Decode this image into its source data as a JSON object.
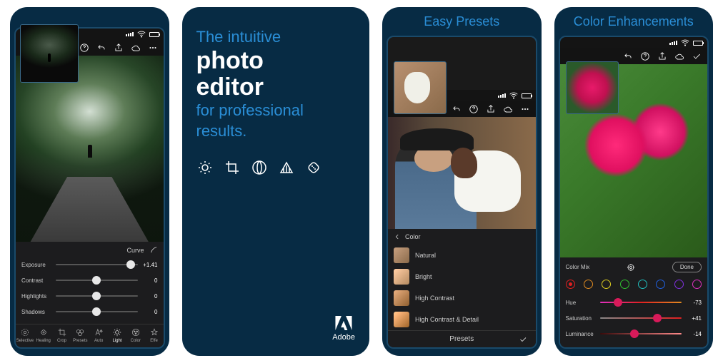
{
  "cards": {
    "editor": {
      "curve_label": "Curve",
      "sliders": [
        {
          "label": "Exposure",
          "value": "+1.41",
          "pos": 92
        },
        {
          "label": "Contrast",
          "value": "0",
          "pos": 50
        },
        {
          "label": "Highlights",
          "value": "0",
          "pos": 50
        },
        {
          "label": "Shadows",
          "value": "0",
          "pos": 50
        }
      ],
      "tools": [
        "Selective",
        "Healing",
        "Crop",
        "Presets",
        "Auto",
        "Light",
        "Color",
        "Effe"
      ]
    },
    "promo": {
      "line1": "The intuitive",
      "line2": "photo",
      "line3": "editor",
      "line4": "for professional results.",
      "brand": "Adobe"
    },
    "presets": {
      "title": "Easy Presets",
      "group": "Color",
      "items": [
        "Natural",
        "Bright",
        "High Contrast",
        "High Contrast & Detail"
      ],
      "footer": "Presets"
    },
    "color": {
      "title": "Color Enhancements",
      "section": "Color Mix",
      "done": "Done",
      "circles": [
        "#e02020",
        "#e08a20",
        "#e0d020",
        "#30c030",
        "#20c0c0",
        "#2060e0",
        "#8030e0",
        "#e030c0"
      ],
      "selected": 0,
      "sliders": [
        {
          "label": "Hue",
          "value": "-73",
          "pos": 22
        },
        {
          "label": "Saturation",
          "value": "+41",
          "pos": 70
        },
        {
          "label": "Luminance",
          "value": "-14",
          "pos": 42
        }
      ]
    }
  }
}
